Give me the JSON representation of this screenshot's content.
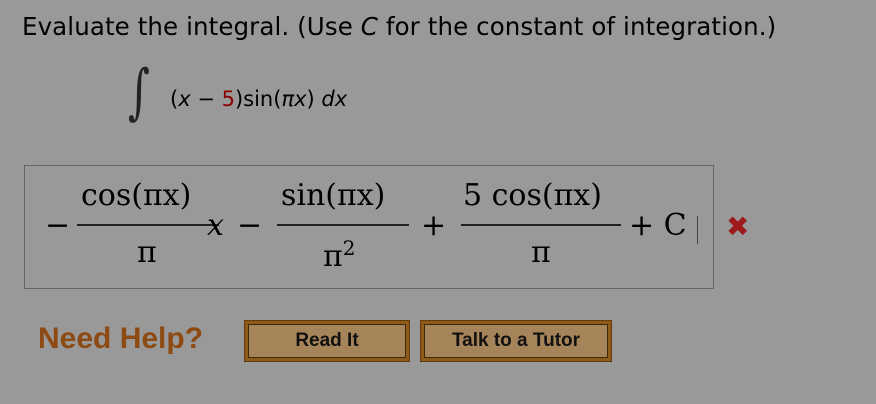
{
  "question": {
    "prefix": "Evaluate the integral. (Use ",
    "var": "C",
    "suffix": " for the constant of integration.)"
  },
  "integral": {
    "sign": "∫",
    "open": "(",
    "x": "x",
    "minus": " − ",
    "constant": "5",
    "rest": ")sin(",
    "pi": "π",
    "x2": "x",
    "close": ") ",
    "dx": "dx"
  },
  "answer": {
    "lead_minus": "−",
    "frac1_num": "cos(πx)",
    "frac1_den": "π",
    "x_term": "x",
    "minus2": "−",
    "frac2_num": "sin(πx)",
    "frac2_den": "π",
    "frac2_den_exp": "2",
    "plus1": "+",
    "frac3_num": "5 cos(πx)",
    "frac3_den": "π",
    "plus_c": "+ C",
    "status_mark": "✖",
    "status_color": "#9d1b1b"
  },
  "help": {
    "label": "Need Help?",
    "buttons": [
      "Read It",
      "Talk to a Tutor"
    ]
  }
}
